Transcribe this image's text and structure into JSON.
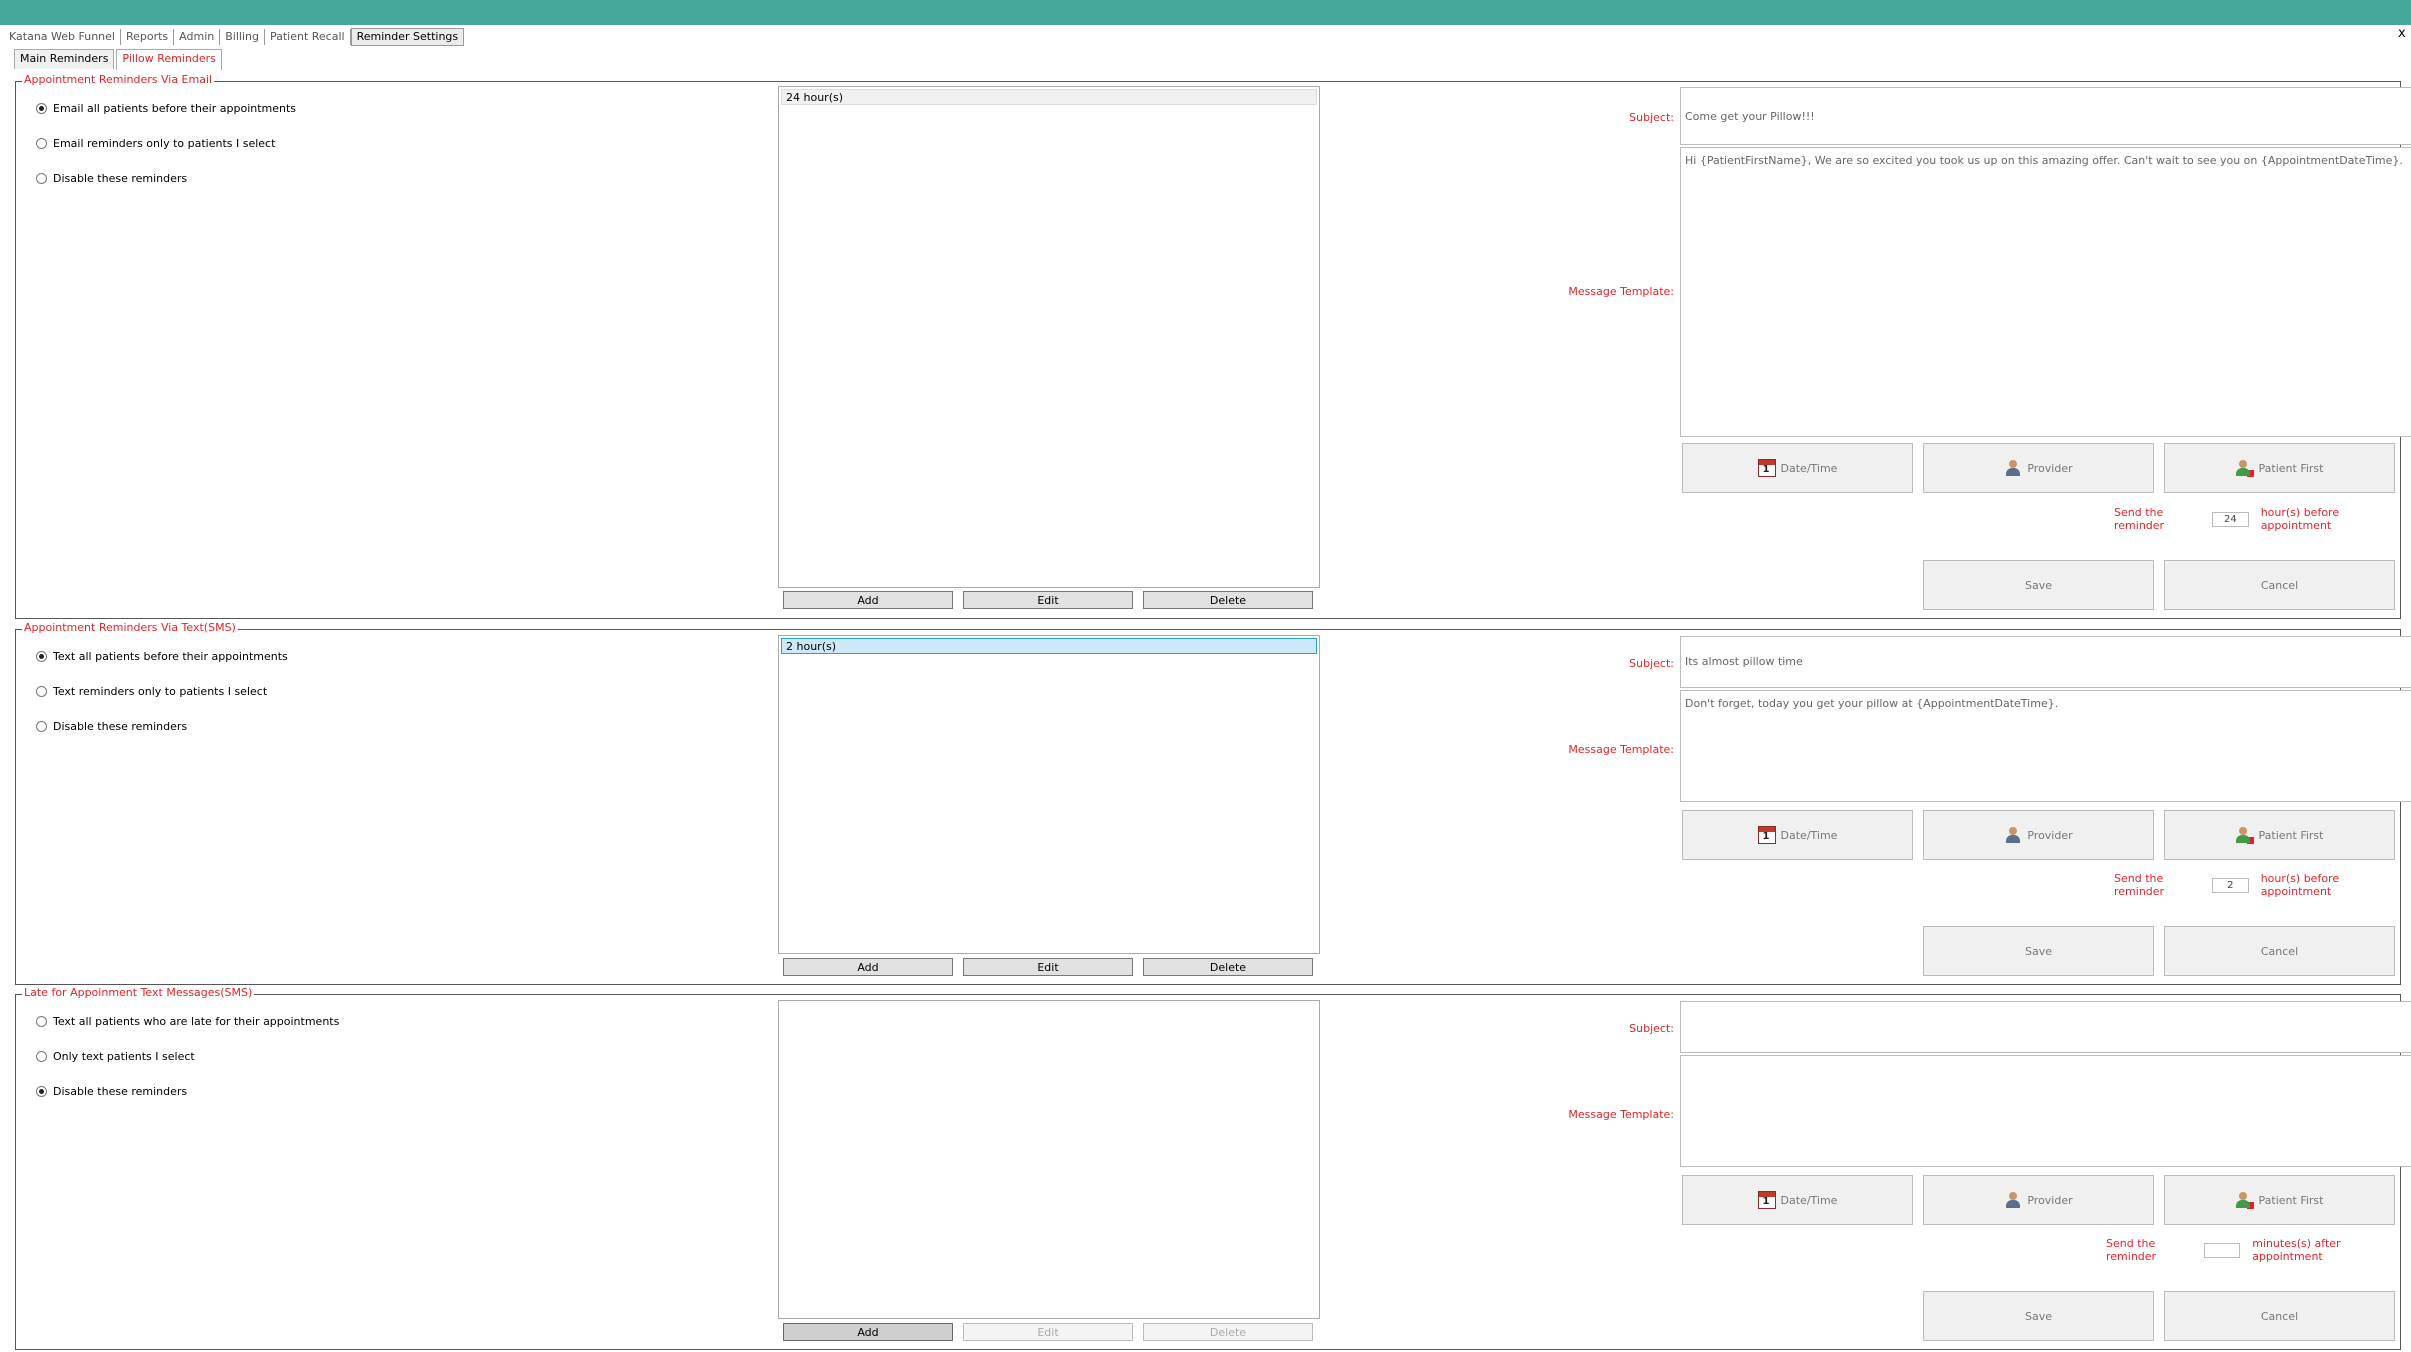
{
  "menu": [
    "Katana Web Funnel",
    "Reports",
    "Admin",
    "Billing",
    "Patient Recall",
    "Reminder Settings"
  ],
  "tabs": [
    "Main Reminders",
    "Pillow Reminders"
  ],
  "corner_glyph": "x",
  "labels": {
    "subject": "Subject:",
    "message_template": "Message Template:",
    "send_prefix": "Send the reminder",
    "date_time": "Date/Time",
    "provider": "Provider",
    "patient_first": "Patient First",
    "save": "Save",
    "cancel": "Cancel",
    "add": "Add",
    "edit": "Edit",
    "delete": "Delete"
  },
  "email": {
    "title": "Appointment Reminders Via Email",
    "options": [
      "Email all patients before their appointments",
      "Email reminders only to patients I select",
      "Disable these reminders"
    ],
    "selected_option": 0,
    "list": [
      "24 hour(s)"
    ],
    "subject": "Come get your Pillow!!!",
    "message": "Hi {PatientFirstName}, We are so excited you took us up on this amazing offer. Can't wait to see you on {AppointmentDateTime}.",
    "send_value": "24",
    "send_suffix": "hour(s) before appointment"
  },
  "sms": {
    "title": "Appointment Reminders Via Text(SMS)",
    "options": [
      "Text all patients before their appointments",
      "Text reminders only to patients I select",
      "Disable these reminders"
    ],
    "selected_option": 0,
    "list": [
      "2 hour(s)"
    ],
    "subject": "Its almost pillow time",
    "message": "Don't forget, today you get your pillow at {AppointmentDateTime}.",
    "send_value": "2",
    "send_suffix": "hour(s) before appointment"
  },
  "late": {
    "title": "Late for Appoinment Text Messages(SMS)",
    "options": [
      "Text all patients who are late for their appointments",
      "Only text patients I select",
      "Disable these reminders"
    ],
    "selected_option": 2,
    "subject": "",
    "message": "",
    "send_value": "",
    "send_suffix": "minutes(s) after appointment"
  },
  "colors": {
    "titlebar": "#45a89a",
    "accent_red": "#e0242b",
    "selection": "#cde8f7"
  },
  "icons": [
    "calendar-icon",
    "provider-icon",
    "patient-icon"
  ]
}
